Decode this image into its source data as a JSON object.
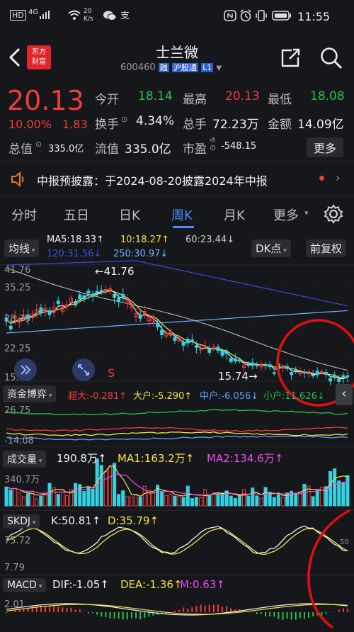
{
  "status": {
    "left": [
      "HD",
      "4G",
      "20 K/s"
    ],
    "time": "11:55"
  },
  "header": {
    "logo_line1": "东方",
    "logo_line2": "财富",
    "title": "士兰微",
    "code": "600460",
    "tag_rong": "融",
    "tag_hgt": "沪股通",
    "tag_level": "L1"
  },
  "quote": {
    "price": "20.13",
    "change_pct": "10.00%",
    "change": "1.83",
    "open_label": "今开",
    "open": "18.14",
    "high_label": "最高",
    "high": "20.13",
    "low_label": "最低",
    "low": "18.08",
    "turnover_rate_label": "换手",
    "turnover_rate": "4.34%",
    "volume_label": "总手",
    "volume": "72.23万",
    "amount_label": "金额",
    "amount": "14.09亿",
    "total_cap_label": "总值",
    "total_cap": "335.0亿",
    "float_cap_label": "流值",
    "float_cap": "335.0亿",
    "pe_label": "市盈",
    "pe_sup": "动",
    "pe": "-548.15",
    "more": "更多"
  },
  "notice": {
    "text": "中报预披露：于2024-08-20披露2024年中报"
  },
  "tabs": [
    "分时",
    "五日",
    "日K",
    "周K",
    "月K",
    "更多"
  ],
  "tabs_more_arrow": "▾",
  "active_tab": "周K",
  "kline": {
    "indicator": "均线",
    "ma5": "MA5:18.33↑",
    "ma10": "10:18.27↑",
    "ma60": "60:23.44↓",
    "ma120": "120:31.56↓",
    "ma250": "250:30.97↓",
    "dk_button": "DK点",
    "adjust_button": "前复权",
    "y_labels": [
      "41.76",
      "35.25",
      "28.75",
      "22.25",
      "15.74"
    ],
    "high_annotation": "←41.76",
    "low_annotation": "15.74→",
    "s_marker": "S"
  },
  "fund": {
    "title": "资金博弈",
    "super": "超大:-0.281↑",
    "large": "大户:-5.290↑",
    "mid": "中户:-6.056↓",
    "small": "小户:11.626↓",
    "y_top": "26.75",
    "y_bottom": "-14.08"
  },
  "volume": {
    "title": "成交量",
    "value": "190.8万↑",
    "ma1": "MA1:163.2万↑",
    "ma2": "MA2:134.6万↑",
    "y_top": "340.7万"
  },
  "skdj": {
    "title": "SKDJ",
    "k": "K:50.81↑",
    "d": "D:35.79↑",
    "y_top": "75.72",
    "y_bottom": "7.79",
    "right_label": "50"
  },
  "macd": {
    "title": "MACD",
    "dif": "DIF:-1.05↑",
    "dea": "DEA:-1.36↑",
    "m": "M:0.63↑",
    "y_top": "2.01"
  },
  "colors": {
    "up": "#f23b3b",
    "down": "#26c24a",
    "background": "#16171b",
    "annotation_circle": "#e01010"
  }
}
